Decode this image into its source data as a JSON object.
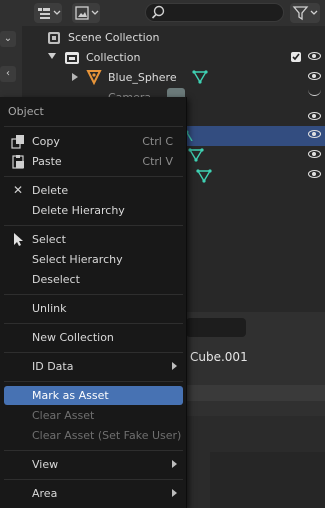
{
  "outliner": {
    "rows": {
      "scene_collection": "Scene Collection",
      "collection": "Collection",
      "blue_sphere": "Blue_Sphere",
      "camera": "Camera"
    }
  },
  "properties": {
    "object_name": "Cube.001"
  },
  "context_menu": {
    "title": "Object",
    "items": {
      "copy": {
        "label": "Copy",
        "shortcut": "Ctrl C"
      },
      "paste": {
        "label": "Paste",
        "shortcut": "Ctrl V"
      },
      "delete": {
        "label": "Delete"
      },
      "delete_hierarchy": {
        "label": "Delete Hierarchy"
      },
      "select": {
        "label": "Select"
      },
      "select_hierarchy": {
        "label": "Select Hierarchy"
      },
      "deselect": {
        "label": "Deselect"
      },
      "unlink": {
        "label": "Unlink"
      },
      "new_collection": {
        "label": "New Collection"
      },
      "id_data": {
        "label": "ID Data"
      },
      "mark_as_asset": {
        "label": "Mark as Asset"
      },
      "clear_asset": {
        "label": "Clear Asset"
      },
      "clear_asset_fake_user": {
        "label": "Clear Asset (Set Fake User)"
      },
      "view": {
        "label": "View"
      },
      "area": {
        "label": "Area"
      }
    }
  },
  "colors": {
    "menu_bg": "#181818",
    "highlight": "#4772b3",
    "selected_row": "#334d80",
    "mesh_icon": "#3fd2b4"
  }
}
